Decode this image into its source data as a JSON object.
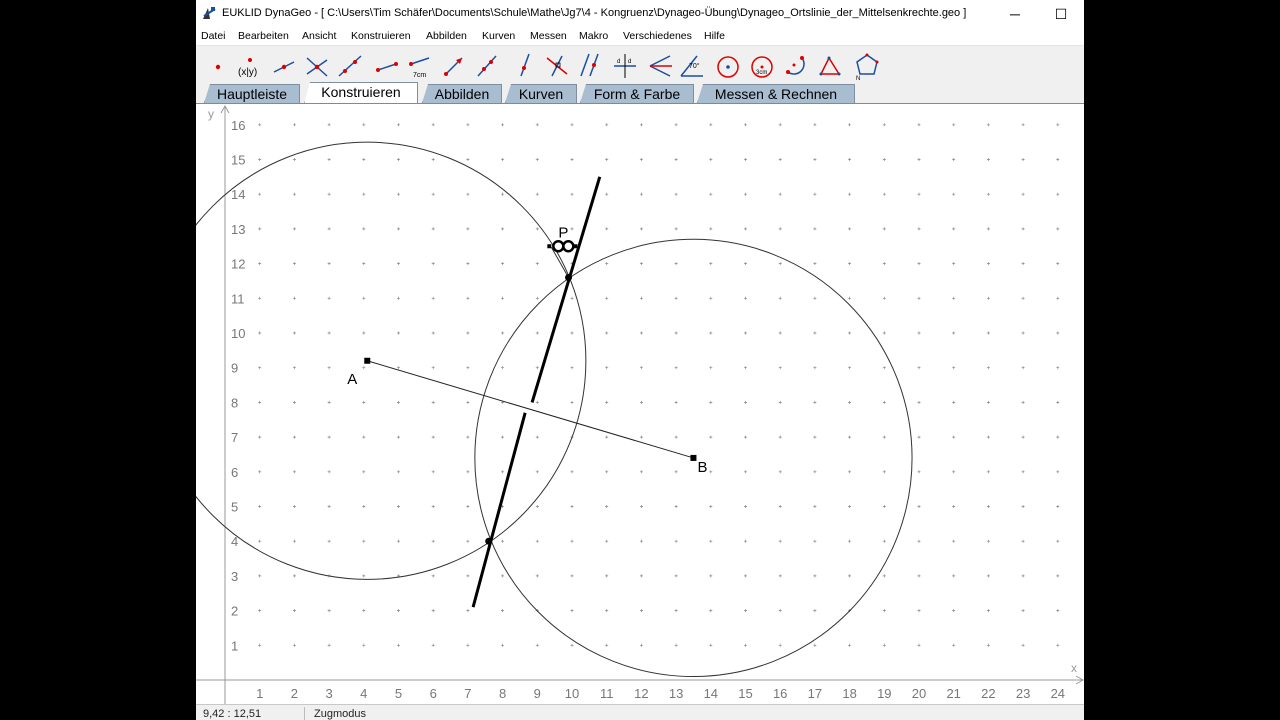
{
  "window": {
    "title": "EUKLID DynaGeo - [ C:\\Users\\Tim Schäfer\\Documents\\Schule\\Mathe\\Jg7\\4 - Kongruenz\\Dynageo-Übung\\Dynageo_Ortslinie_der_Mittelsenkrechte.geo ]",
    "minimize": "─",
    "maximize": "☐",
    "close": "✕"
  },
  "menu": [
    "Datei",
    "Bearbeiten",
    "Ansicht",
    "Konstruieren",
    "Abbilden",
    "Kurven",
    "Messen",
    "Makro",
    "Verschiedenes",
    "Hilfe"
  ],
  "toolbar": {
    "tools": [
      {
        "icon": "point-tool-icon"
      },
      {
        "icon": "coordinate-point-tool-icon",
        "label": "(x|y)"
      },
      {
        "icon": "point-on-line-tool-icon"
      },
      {
        "icon": "intersection-point-tool-icon"
      },
      {
        "icon": "line-tool-icon"
      },
      {
        "icon": "segment-tool-icon"
      },
      {
        "icon": "segment-length-tool-icon",
        "label": "7cm"
      },
      {
        "icon": "ray-tool-icon"
      },
      {
        "icon": "line-through-points-tool-icon"
      },
      {
        "icon": "perpendicular-tool-icon"
      },
      {
        "icon": "right-angle-tool-icon"
      },
      {
        "icon": "parallel-tool-icon"
      },
      {
        "icon": "midpoint-tool-icon"
      },
      {
        "icon": "angle-bisector-tool-icon"
      },
      {
        "icon": "angle-tool-icon",
        "label": "70°"
      },
      {
        "icon": "circle-tool-icon"
      },
      {
        "icon": "circle-radius-tool-icon",
        "label": "3cm"
      },
      {
        "icon": "arc-tool-icon"
      },
      {
        "icon": "triangle-tool-icon"
      },
      {
        "icon": "polygon-tool-icon",
        "label": "N"
      }
    ]
  },
  "tabs": [
    "Hauptleiste",
    "Konstruieren",
    "Abbilden",
    "Kurven",
    "Form & Farbe",
    "Messen & Rechnen"
  ],
  "active_tab": "Konstruieren",
  "canvas": {
    "x_axis_label": "x",
    "y_axis_label": "y",
    "x_ticks": [
      "1",
      "2",
      "3",
      "4",
      "5",
      "6",
      "7",
      "8",
      "9",
      "10",
      "11",
      "12",
      "13",
      "14",
      "15",
      "16",
      "17",
      "18",
      "19",
      "20",
      "21",
      "22",
      "23",
      "24"
    ],
    "y_ticks": [
      "1",
      "2",
      "3",
      "4",
      "5",
      "6",
      "7",
      "8",
      "9",
      "10",
      "11",
      "12",
      "13",
      "14",
      "15",
      "16"
    ],
    "points": {
      "A": {
        "label": "A",
        "x": 4.1,
        "y": 9.2
      },
      "B": {
        "label": "B",
        "x": 13.5,
        "y": 6.4
      },
      "P": {
        "label": "P",
        "x": 9.75,
        "y": 12.5
      }
    },
    "circles": [
      {
        "center": "A",
        "radius": 6.3
      },
      {
        "center": "B",
        "radius": 6.3
      }
    ],
    "intersections": [
      {
        "x": 9.9,
        "y": 11.6
      },
      {
        "x": 7.6,
        "y": 4.0
      }
    ],
    "perpendicular_bisector_segments": [
      {
        "from": {
          "x": 7.15,
          "y": 2.1
        },
        "to": {
          "x": 8.65,
          "y": 7.7
        }
      },
      {
        "from": {
          "x": 8.85,
          "y": 8.0
        },
        "to": {
          "x": 10.8,
          "y": 14.5
        }
      }
    ]
  },
  "status": {
    "coords": "9,42 : 12,51",
    "mode": "Zugmodus"
  }
}
